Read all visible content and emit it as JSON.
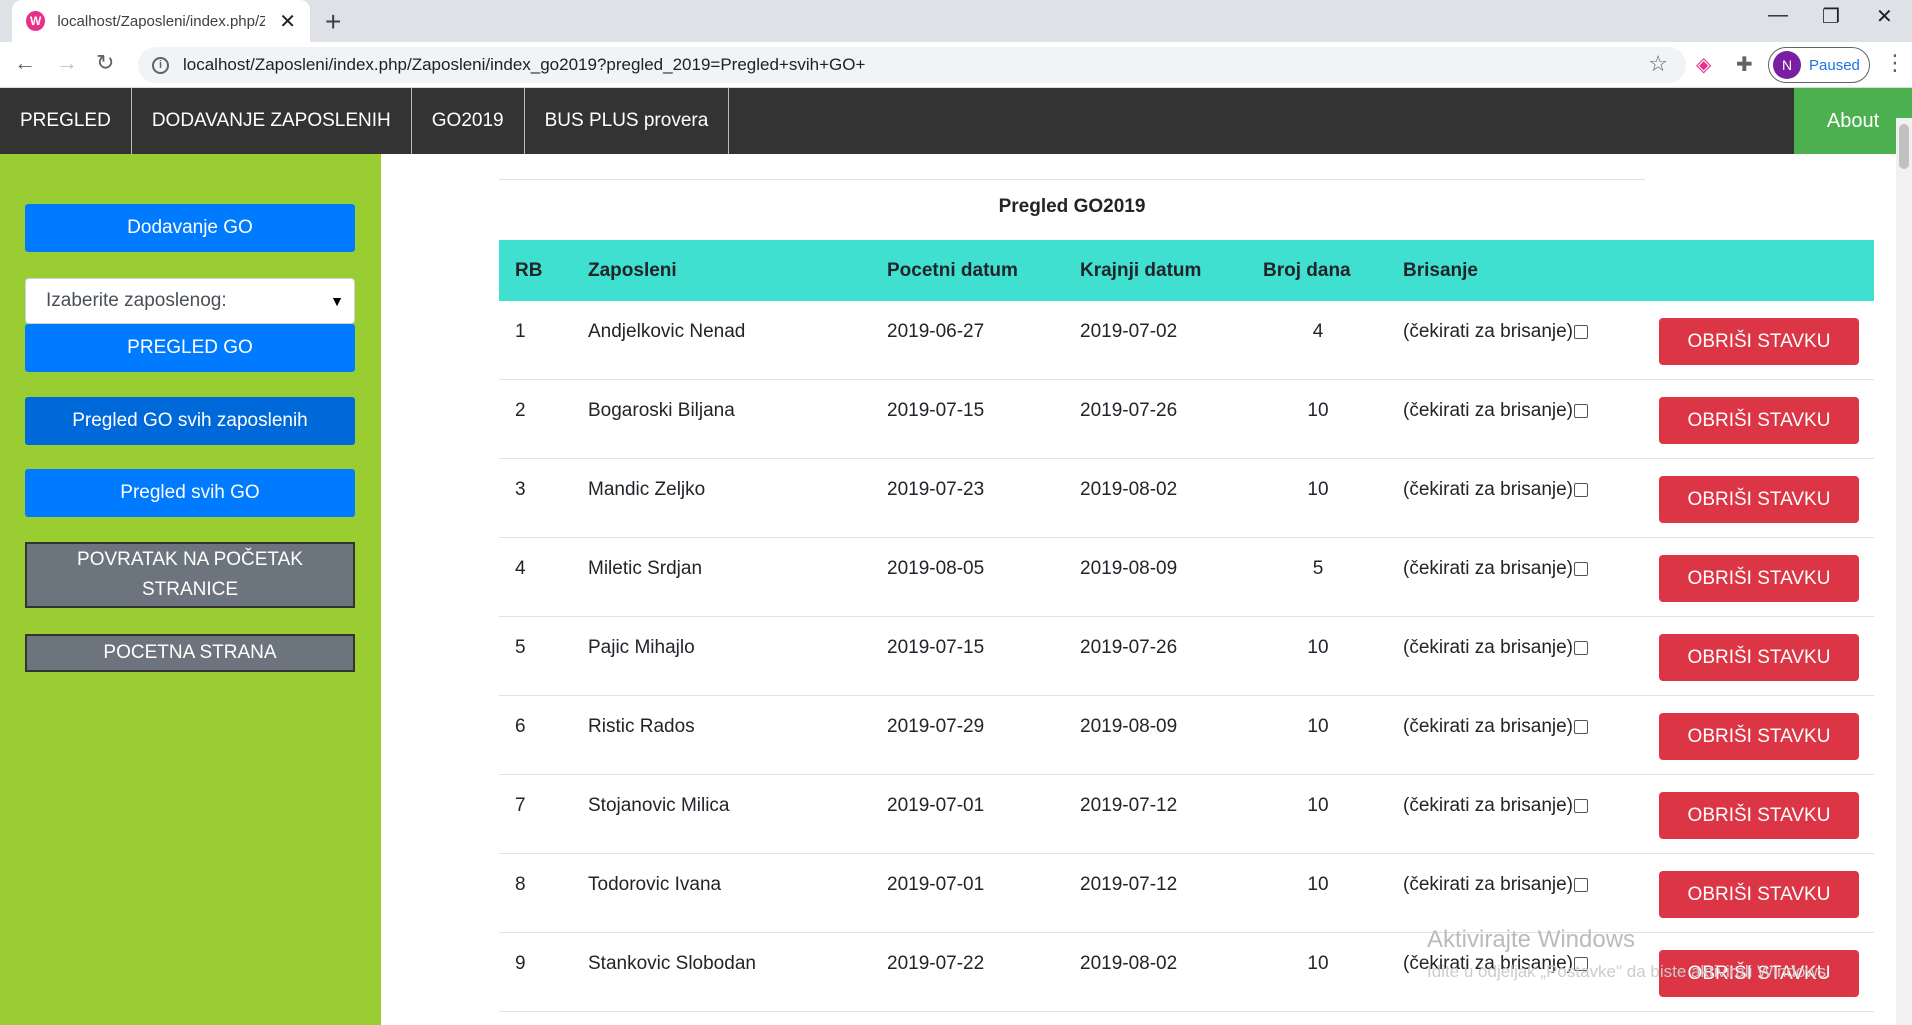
{
  "browser": {
    "tab_title": "localhost/Zaposleni/index.php/Z",
    "favicon": "W",
    "url": "localhost/Zaposleni/index.php/Zaposleni/index_go2019?pregled_2019=Pregled+svih+GO+",
    "profile_initial": "N",
    "profile_status": "Paused"
  },
  "nav": {
    "items": [
      "PREGLED",
      "DODAVANJE ZAPOSLENIH",
      "GO2019",
      "BUS PLUS provera"
    ],
    "about": "About"
  },
  "sidebar": {
    "add_go": "Dodavanje GO",
    "select_placeholder": "Izaberite zaposlenog:",
    "pregled_go": "PREGLED GO",
    "pregled_svih_zaposlenih": "Pregled GO svih zaposlenih",
    "pregled_svih_go": "Pregled svih GO",
    "povratak": "POVRATAK NA POČETAK STRANICE",
    "pocetna": "POCETNA STRANA"
  },
  "main": {
    "caption": "Pregled GO2019",
    "headers": [
      "RB",
      "Zaposleni",
      "Pocetni datum",
      "Krajnji datum",
      "Broj dana",
      "Brisanje"
    ],
    "checkbox_label": "(čekirati za brisanje)",
    "delete_label": "OBRIŠI STAVKU",
    "rows": [
      {
        "rb": "1",
        "name": "Andjelkovic Nenad",
        "start": "2019-06-27",
        "end": "2019-07-02",
        "days": "4"
      },
      {
        "rb": "2",
        "name": "Bogaroski Biljana",
        "start": "2019-07-15",
        "end": "2019-07-26",
        "days": "10"
      },
      {
        "rb": "3",
        "name": "Mandic Zeljko",
        "start": "2019-07-23",
        "end": "2019-08-02",
        "days": "10"
      },
      {
        "rb": "4",
        "name": "Miletic Srdjan",
        "start": "2019-08-05",
        "end": "2019-08-09",
        "days": "5"
      },
      {
        "rb": "5",
        "name": "Pajic Mihajlo",
        "start": "2019-07-15",
        "end": "2019-07-26",
        "days": "10"
      },
      {
        "rb": "6",
        "name": "Ristic Rados",
        "start": "2019-07-29",
        "end": "2019-08-09",
        "days": "10"
      },
      {
        "rb": "7",
        "name": "Stojanovic Milica",
        "start": "2019-07-01",
        "end": "2019-07-12",
        "days": "10"
      },
      {
        "rb": "8",
        "name": "Todorovic Ivana",
        "start": "2019-07-01",
        "end": "2019-07-12",
        "days": "10"
      },
      {
        "rb": "9",
        "name": "Stankovic Slobodan",
        "start": "2019-07-22",
        "end": "2019-08-02",
        "days": "10"
      }
    ]
  },
  "watermark": {
    "line1": "Aktivirajte Windows",
    "line2": "Idite u odjeljak „Postavke\" da biste aktivirali Windows."
  }
}
